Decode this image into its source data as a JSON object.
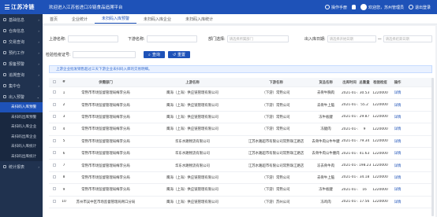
{
  "header": {
    "brand": "江苏冷链",
    "system_title": "欢迎进入江苏省进口冷链食品追溯平台",
    "manual": "操作手册",
    "welcome": "欢迎您，苏州管理员",
    "logout": "退出登录"
  },
  "sidebar": {
    "items": [
      {
        "label": "基础信息"
      },
      {
        "label": "仓库信息"
      },
      {
        "label": "交易查询"
      },
      {
        "label": "预约工作"
      },
      {
        "label": "报备预警"
      },
      {
        "label": "追溯查询"
      },
      {
        "label": "集中仓"
      },
      {
        "label": "出入预警"
      }
    ],
    "subitems": [
      {
        "label": "未扫码入库预警"
      },
      {
        "label": "未扫码出库预警"
      },
      {
        "label": "未扫码入库企业"
      },
      {
        "label": "未扫码出库企业"
      },
      {
        "label": "未扫码入库统计"
      },
      {
        "label": "未扫码出库统计"
      }
    ],
    "last": {
      "label": "统计报表"
    }
  },
  "tabs": [
    {
      "label": "首页"
    },
    {
      "label": "企业统计"
    },
    {
      "label": "未扫码入库预警"
    },
    {
      "label": "未扫码入库企业"
    },
    {
      "label": "未扫码入库统计"
    }
  ],
  "filters": {
    "upstream_label": "上游名称:",
    "downstream_label": "下游名称:",
    "dept_label": "部门选择:",
    "dept_placeholder": "请选择所属部门",
    "date_label": "出入库日期:",
    "date_start_placeholder": "请选择开始日期",
    "date_sep": "—",
    "date_end_placeholder": "请选择结束日期",
    "cert_label": "检验检疫证号:",
    "search_button": "查询",
    "reset_button": "重置"
  },
  "notice": "上游企业批发销售超过三天下游企业未扫码入库的交易明细。",
  "table": {
    "headers": [
      "#",
      "供需部门",
      "上游名称",
      "下游名称",
      "货品名称",
      "出库时间",
      "总重量",
      "检验检疫",
      "操作"
    ],
    "rows": [
      {
        "no": "1",
        "dept": "常熟市市场监督管理局梅李分局",
        "up": "鹰海（上海）供应链管理有限公司",
        "down": "（下游）常熟公司",
        "goods": "去骨牛胸肉",
        "date": "2021-01-11",
        "weight": "30.53",
        "cert": "1220000",
        "op": "详情"
      },
      {
        "no": "2",
        "dept": "常熟市市场监督管理局梅李分局",
        "up": "鹰海（上海）供应链管理有限公司",
        "down": "（下游）常熟公司",
        "goods": "去骨牛上脑",
        "date": "2021-01-11",
        "weight": "55.2",
        "cert": "1220000",
        "op": "详情"
      },
      {
        "no": "3",
        "dept": "常熟市市场监督管理局梅李分局",
        "up": "鹰海（上海）供应链管理有限公司",
        "down": "（下游）常熟公司",
        "goods": "冻牛板腱",
        "date": "2021-01-11",
        "weight": "29.87",
        "cert": "1220000",
        "op": "详情"
      },
      {
        "no": "4",
        "dept": "常熟市市场监督管理局梅李分局",
        "up": "鹰海（上海）供应链管理有限公司",
        "down": "（下游）常熟公司",
        "goods": "冻腿肉",
        "date": "2021-01-11",
        "weight": "9",
        "cert": "1220000",
        "op": "详情"
      },
      {
        "no": "5",
        "dept": "常熟市市场监督管理局梅李分局",
        "up": "华东水路物流有限公司",
        "down": "江苏水路超市有限公司常熟珠江路店",
        "goods": "去骨牛肉公牛牛腱",
        "date": "2021-01-13",
        "weight": "79.34",
        "cert": "1220000",
        "op": "详情"
      },
      {
        "no": "6",
        "dept": "常熟市市场监督管理局梅李分局",
        "up": "华东水路物流有限公司",
        "down": "江苏水路超市有限公司常熟珠江路店",
        "goods": "去骨牛肉公牛腰肉",
        "date": "2021-01-13",
        "weight": "41.63",
        "cert": "1220000",
        "op": "详情"
      },
      {
        "no": "7",
        "dept": "常熟市市场监督管理局梅李分局",
        "up": "华东水路物流有限公司",
        "down": "江苏水路超市有限公司常熟珠江路店",
        "goods": "冻去骨牛肉",
        "date": "2021-01-13",
        "weight": "198.23",
        "cert": "1220000",
        "op": "详情"
      },
      {
        "no": "8",
        "dept": "常熟市市场监督管理局梅李分局",
        "up": "鹰海（上海）供应链管理有限公司",
        "down": "（下游）常熟公司",
        "goods": "去骨牛上脑",
        "date": "2021-01-13",
        "weight": "34.18",
        "cert": "1220000",
        "op": "详情"
      },
      {
        "no": "9",
        "dept": "常熟市市场监督管理局梅李分局",
        "up": "鹰海（上海）供应链管理有限公司",
        "down": "（下游）常熟公司",
        "goods": "冻牛板腱",
        "date": "2021-01-13",
        "weight": "16",
        "cert": "1220000",
        "op": "详情"
      },
      {
        "no": "10",
        "dept": "苏州市吴中区市场监督管理局胥口分局",
        "up": "鹰海（上海）供应链管理有限公司",
        "down": "（下游）苏州公司",
        "goods": "冻鸡肉",
        "date": "2021-01-14",
        "weight": "17.56",
        "cert": "1220000",
        "op": "详情"
      }
    ]
  },
  "colors": {
    "primary": "#1e52b8",
    "sidebar": "#20324f"
  }
}
